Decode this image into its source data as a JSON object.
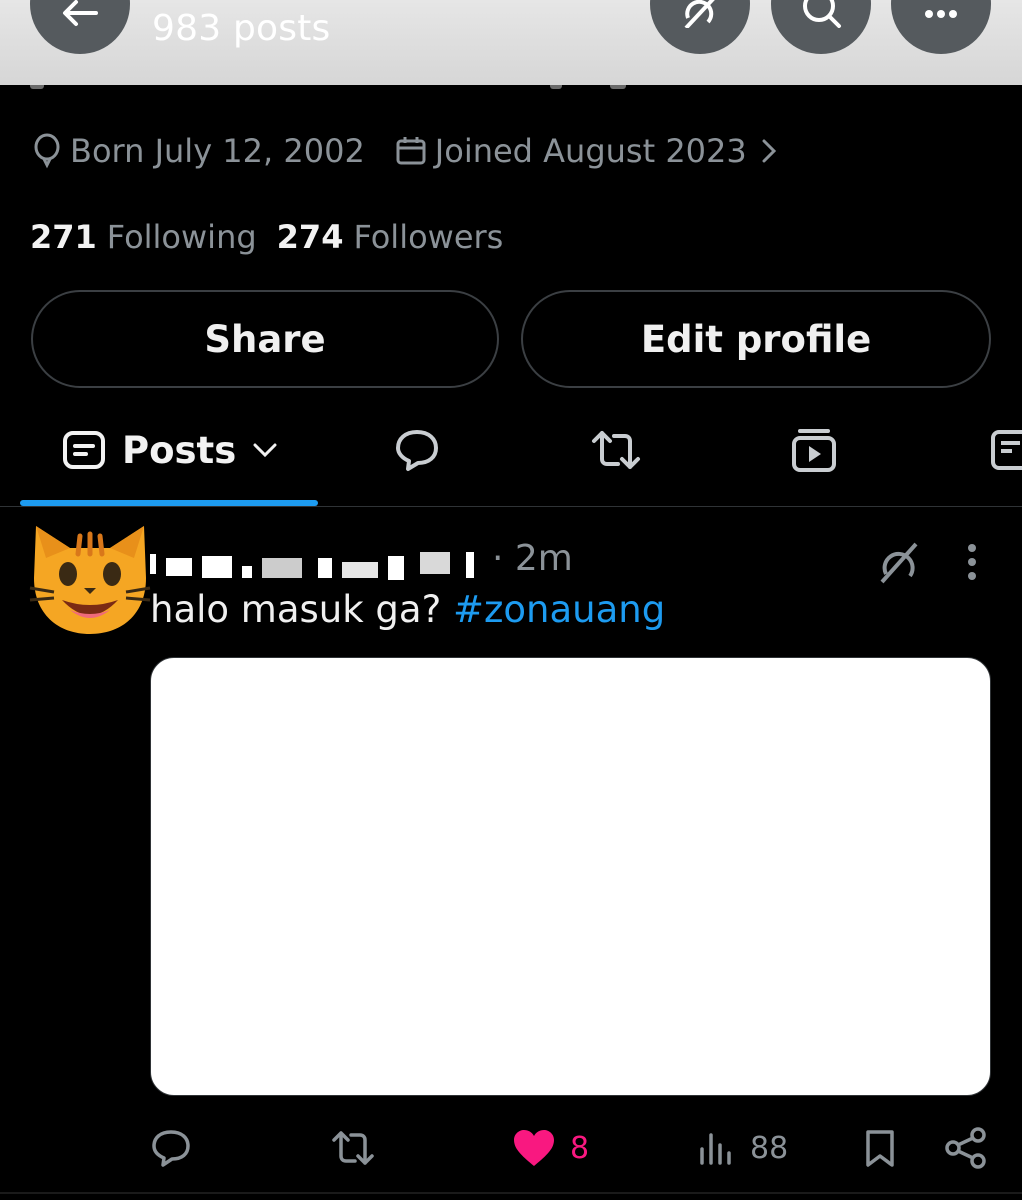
{
  "header": {
    "post_count": "983 posts"
  },
  "profile": {
    "born": "Born July 12, 2002",
    "joined": "Joined August 2023",
    "following_count": "271",
    "following_label": "Following",
    "followers_count": "274",
    "followers_label": "Followers"
  },
  "buttons": {
    "share": "Share",
    "edit_profile": "Edit profile"
  },
  "tabs": {
    "active_label": "Posts",
    "items": [
      "posts",
      "replies",
      "reposts",
      "videos",
      "articles"
    ]
  },
  "post": {
    "time": "· 2m",
    "text": "halo masuk ga? ",
    "hashtag": "#zonauang",
    "avatar_emoji": "smiling-cat-face",
    "like_count": "8",
    "view_count": "88"
  },
  "colors": {
    "accent": "#1d9bf0",
    "like": "#f91880",
    "muted": "#8b9298",
    "background": "#000000"
  }
}
